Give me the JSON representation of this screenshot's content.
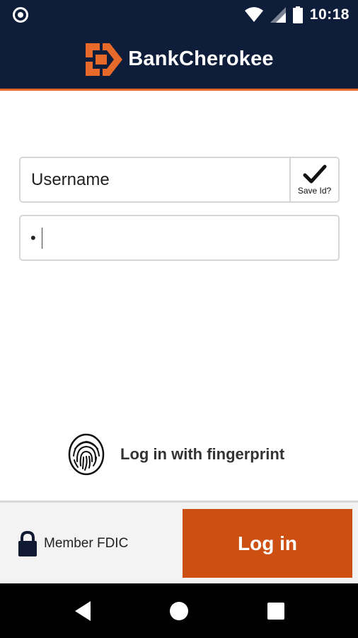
{
  "status_bar": {
    "time": "10:18",
    "icons": [
      "notification-circle-icon",
      "wifi-icon",
      "signal-icon",
      "battery-icon"
    ]
  },
  "header": {
    "brand_name": "BankCherokee",
    "logo_icon": "bankcherokee-logo-icon",
    "accent_color": "#e86a2a",
    "background_color": "#0e1d3a"
  },
  "login_form": {
    "username_placeholder": "Username",
    "save_id_label": "Save Id?",
    "save_id_checked": true,
    "password_value": "•"
  },
  "fingerprint": {
    "label": "Log in with fingerprint",
    "icon": "fingerprint-icon"
  },
  "footer": {
    "fdic_label": "Member FDIC",
    "lock_icon": "lock-icon",
    "login_button_label": "Log in",
    "login_button_color": "#cd5012"
  },
  "nav_bar": {
    "buttons": [
      "back-icon",
      "home-icon",
      "recents-icon"
    ]
  }
}
